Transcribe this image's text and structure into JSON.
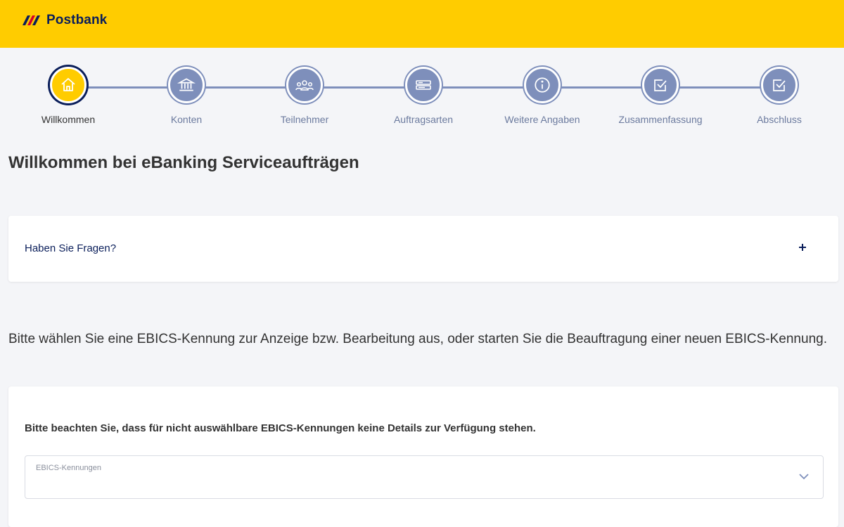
{
  "header": {
    "brand": "Postbank"
  },
  "stepper": {
    "steps": [
      {
        "label": "Willkommen",
        "icon": "home-icon",
        "active": true
      },
      {
        "label": "Konten",
        "icon": "bank-icon"
      },
      {
        "label": "Teilnehmer",
        "icon": "users-icon"
      },
      {
        "label": "Auftragsarten",
        "icon": "order-types-icon"
      },
      {
        "label": "Weitere Angaben",
        "icon": "info-icon"
      },
      {
        "label": "Zusammenfassung",
        "icon": "checkbox-icon"
      },
      {
        "label": "Abschluss",
        "icon": "checkbox-icon"
      }
    ]
  },
  "main": {
    "title": "Willkommen bei eBanking Serviceaufträgen",
    "faq": {
      "title": "Haben Sie Fragen?"
    },
    "intro": "Bitte wählen Sie eine EBICS-Kennung zur Anzeige bzw. Bearbeitung aus, oder starten Sie die Beauftragung einer neuen EBICS-Kennung.",
    "selection": {
      "notice": "Bitte beachten Sie, dass für nicht auswählbare EBICS-Kennungen keine Details zur Verfügung stehen.",
      "select_label": "EBICS-Kennungen"
    }
  },
  "colors": {
    "brand_yellow": "#ffcc00",
    "navy": "#0a1e5a",
    "step_blue": "#7e8fbb",
    "background": "#f4f5f8"
  }
}
